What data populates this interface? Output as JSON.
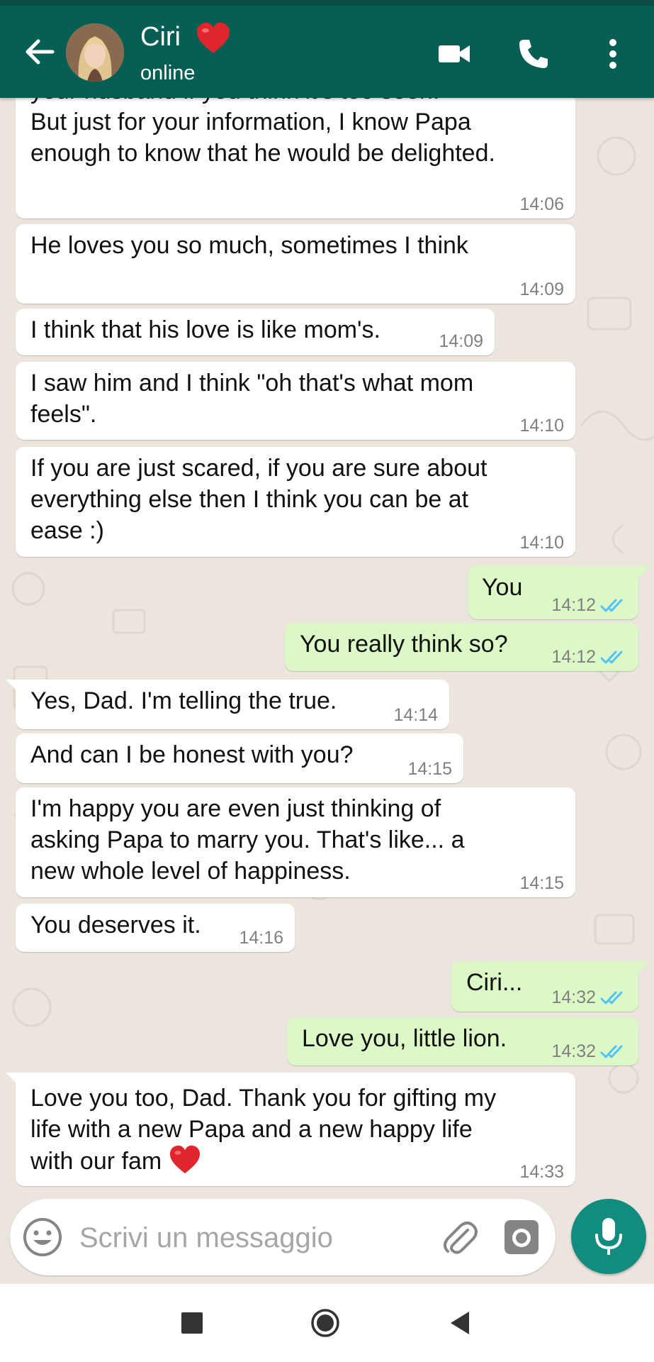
{
  "header": {
    "contact_name": "Ciri",
    "contact_status": "online",
    "accent_color": "#075E54",
    "icons": [
      "back-arrow-icon",
      "avatar",
      "heart-emoji",
      "video-call-icon",
      "phone-icon",
      "more-options-icon"
    ]
  },
  "messages": [
    {
      "dir": "in",
      "text": "your husband if you think it's too soon.\nBut just for your information, I know Papa\nenough to know that he would be delighted.",
      "time": "14:06"
    },
    {
      "dir": "in",
      "text": "He loves you so much, sometimes I think",
      "time": "14:09"
    },
    {
      "dir": "in",
      "text": "I think that his love is like mom's.",
      "time": "14:09"
    },
    {
      "dir": "in",
      "text": "I saw him and I think \"oh that's what mom\nfeels\".",
      "time": "14:10"
    },
    {
      "dir": "in",
      "text": "If you are just scared, if you are sure about\neverything else then I think you can be at\nease :)",
      "time": "14:10"
    },
    {
      "dir": "out",
      "text": "You",
      "time": "14:12"
    },
    {
      "dir": "out",
      "text": "You really think so?",
      "time": "14:12"
    },
    {
      "dir": "in",
      "text": "Yes, Dad. I'm telling the true.",
      "time": "14:14"
    },
    {
      "dir": "in",
      "text": "And can I be honest with you?",
      "time": "14:15"
    },
    {
      "dir": "in",
      "text": "I'm happy you are even just thinking of\nasking Papa to marry you. That's like... a\nnew whole level of happiness.",
      "time": "14:15"
    },
    {
      "dir": "in",
      "text": "You deserves it.",
      "time": "14:16"
    },
    {
      "dir": "out",
      "text": "Ciri...",
      "time": "14:32"
    },
    {
      "dir": "out",
      "text": "Love you, little lion.",
      "time": "14:32"
    },
    {
      "dir": "in",
      "text": "Love you too, Dad. Thank you for gifting my\nlife with a new Papa and a new happy life\nwith our fam",
      "time": "14:33",
      "emoji": "red-heart"
    }
  ],
  "composer": {
    "placeholder": "Scrivi un messaggio",
    "icons": [
      "emoji-icon",
      "attach-icon",
      "camera-icon",
      "mic-icon"
    ]
  },
  "colors": {
    "incoming_bubble": "#FFFFFF",
    "outgoing_bubble": "#DCF8C6",
    "read_ticks": "#4FC3F7",
    "mic_button": "#128C7E",
    "chat_background": "#ECE5DD"
  }
}
